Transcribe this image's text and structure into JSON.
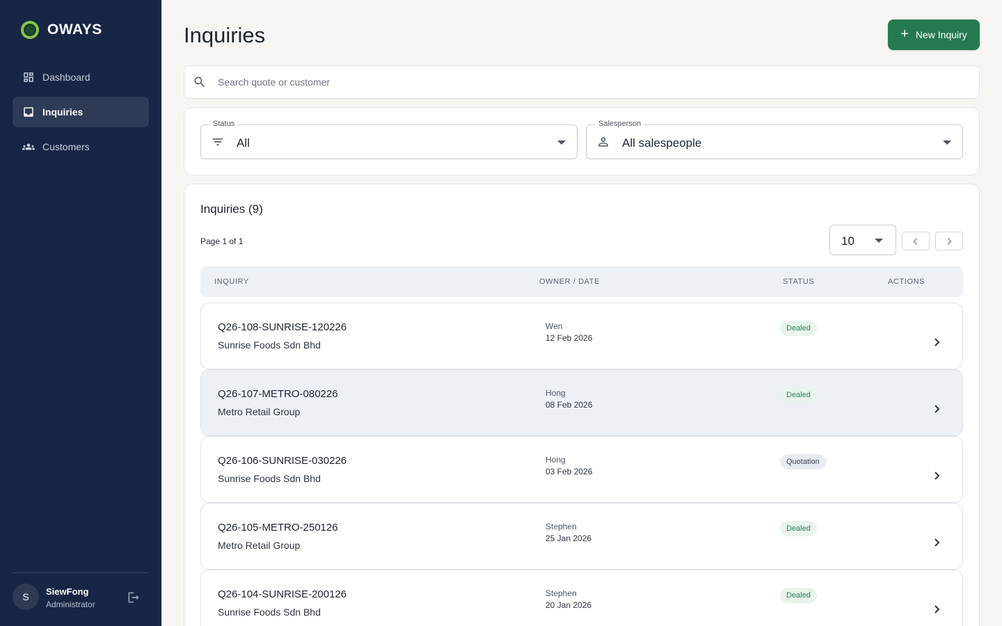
{
  "brand": {
    "name": "OWAYS"
  },
  "nav": [
    {
      "label": "Dashboard",
      "icon": "dashboard-icon"
    },
    {
      "label": "Inquiries",
      "icon": "inbox-icon"
    },
    {
      "label": "Customers",
      "icon": "group-icon"
    }
  ],
  "user": {
    "initial": "S",
    "name": "SiewFong",
    "role": "Administrator"
  },
  "header": {
    "title": "Inquiries",
    "new_button": "New Inquiry"
  },
  "search": {
    "placeholder": "Search quote or customer"
  },
  "filters": {
    "status": {
      "label": "Status",
      "value": "All"
    },
    "salesperson": {
      "label": "Salesperson",
      "value": "All salespeople"
    }
  },
  "list": {
    "title": "Inquiries (9)",
    "page_info": "Page 1 of 1",
    "per_page": "10",
    "columns": {
      "inquiry": "INQUIRY",
      "owner_date": "OWNER / DATE",
      "status": "STATUS",
      "actions": "ACTIONS"
    },
    "rows": [
      {
        "code": "Q26-108-SUNRISE-120226",
        "customer": "Sunrise Foods Sdn Bhd",
        "owner": "Wen",
        "date": "12 Feb 2026",
        "status": "Dealed"
      },
      {
        "code": "Q26-107-METRO-080226",
        "customer": "Metro Retail Group",
        "owner": "Hong",
        "date": "08 Feb 2026",
        "status": "Dealed"
      },
      {
        "code": "Q26-106-SUNRISE-030226",
        "customer": "Sunrise Foods Sdn Bhd",
        "owner": "Hong",
        "date": "03 Feb 2026",
        "status": "Quotation"
      },
      {
        "code": "Q26-105-METRO-250126",
        "customer": "Metro Retail Group",
        "owner": "Stephen",
        "date": "25 Jan 2026",
        "status": "Dealed"
      },
      {
        "code": "Q26-104-SUNRISE-200126",
        "customer": "Sunrise Foods Sdn Bhd",
        "owner": "Stephen",
        "date": "20 Jan 2026",
        "status": "Dealed"
      }
    ]
  },
  "colors": {
    "sidebar": "#172645",
    "accent": "#267a52",
    "dealed": "#2f7d52"
  }
}
